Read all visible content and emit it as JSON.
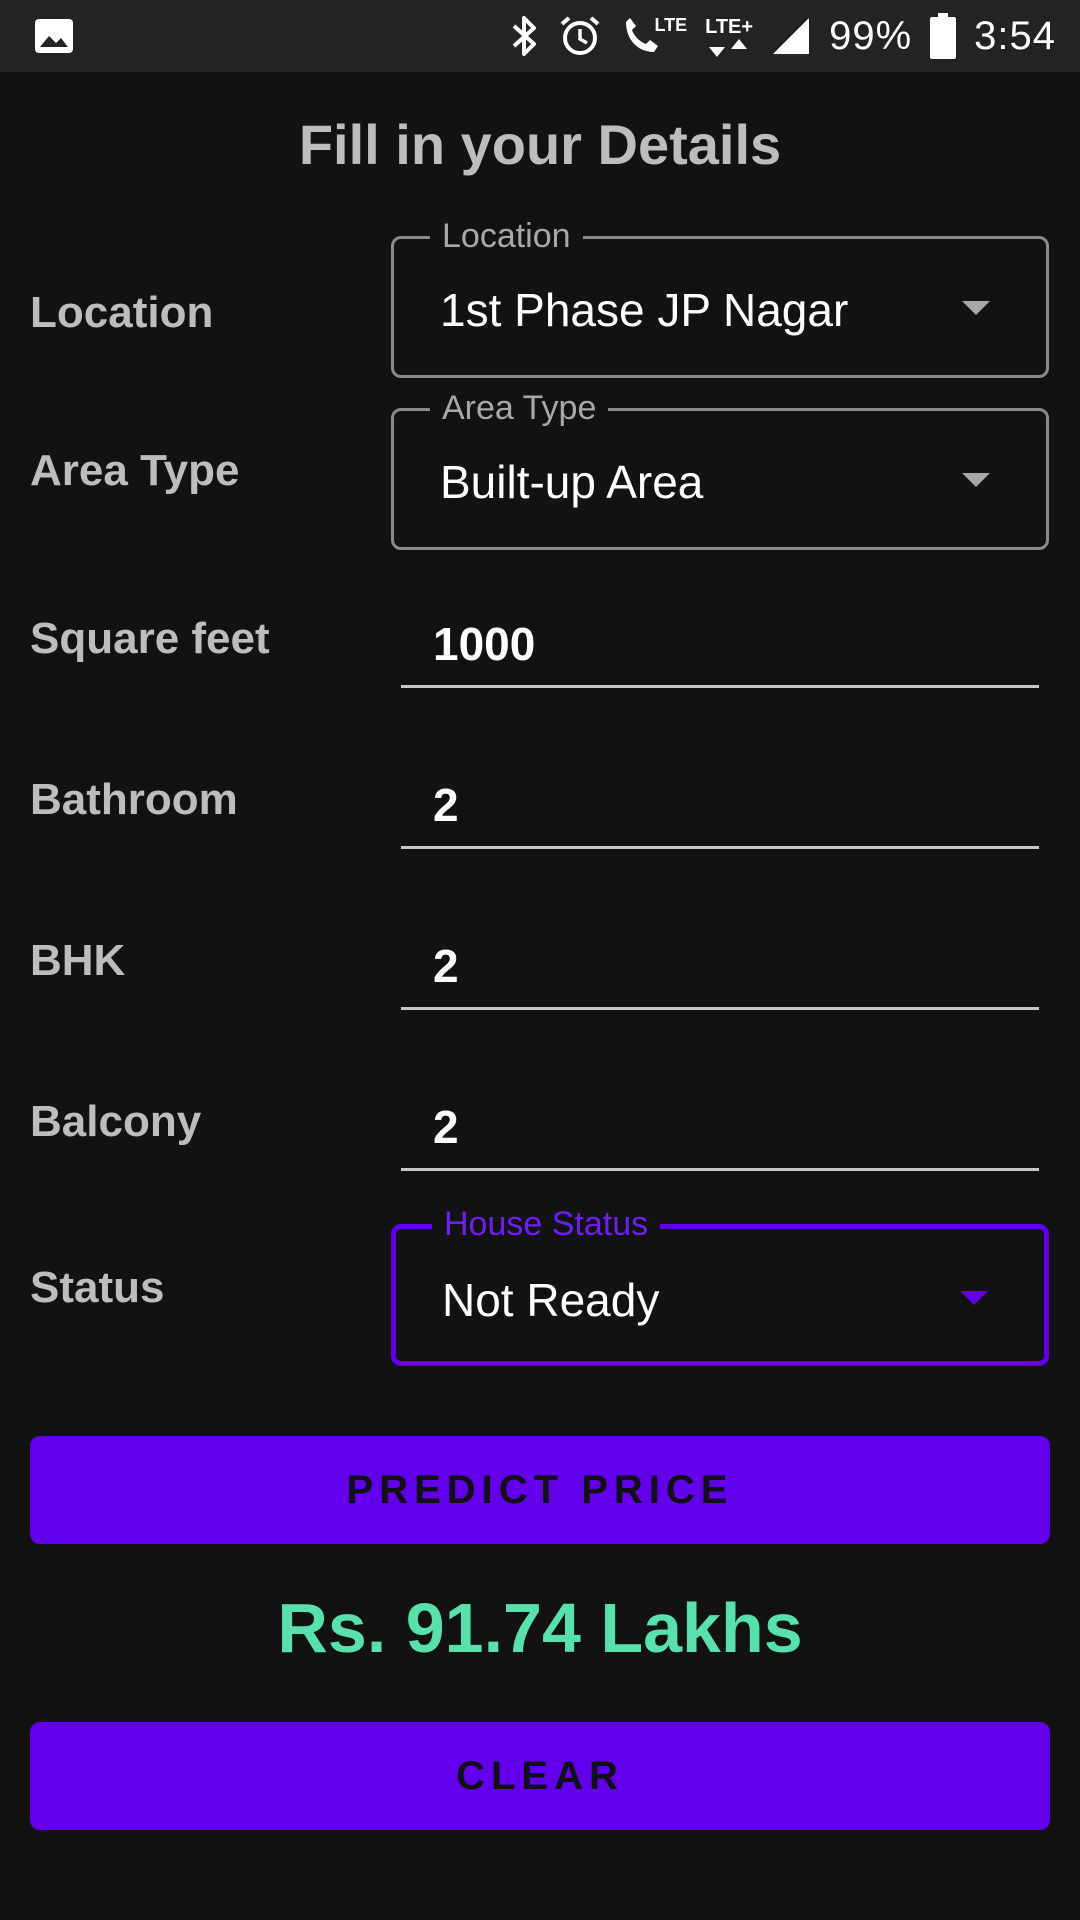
{
  "status_bar": {
    "battery": "99%",
    "time": "3:54",
    "lte_label": "LTE",
    "lte_plus_label": "LTE+"
  },
  "title": "Fill in your Details",
  "form": {
    "location": {
      "label": "Location",
      "field_label": "Location",
      "value": "1st Phase JP Nagar"
    },
    "area_type": {
      "label": "Area Type",
      "field_label": "Area Type",
      "value": "Built-up  Area"
    },
    "square_feet": {
      "label": "Square feet",
      "value": "1000"
    },
    "bathroom": {
      "label": "Bathroom",
      "value": "2"
    },
    "bhk": {
      "label": "BHK",
      "value": "2"
    },
    "balcony": {
      "label": "Balcony",
      "value": "2"
    },
    "status": {
      "label": "Status",
      "field_label": "House Status",
      "value": "Not Ready"
    }
  },
  "buttons": {
    "predict": "PREDICT PRICE",
    "clear": "CLEAR"
  },
  "result": "Rs. 91.74 Lakhs",
  "colors": {
    "accent": "#6200ee",
    "result": "#58e1ac",
    "background": "#121212"
  }
}
